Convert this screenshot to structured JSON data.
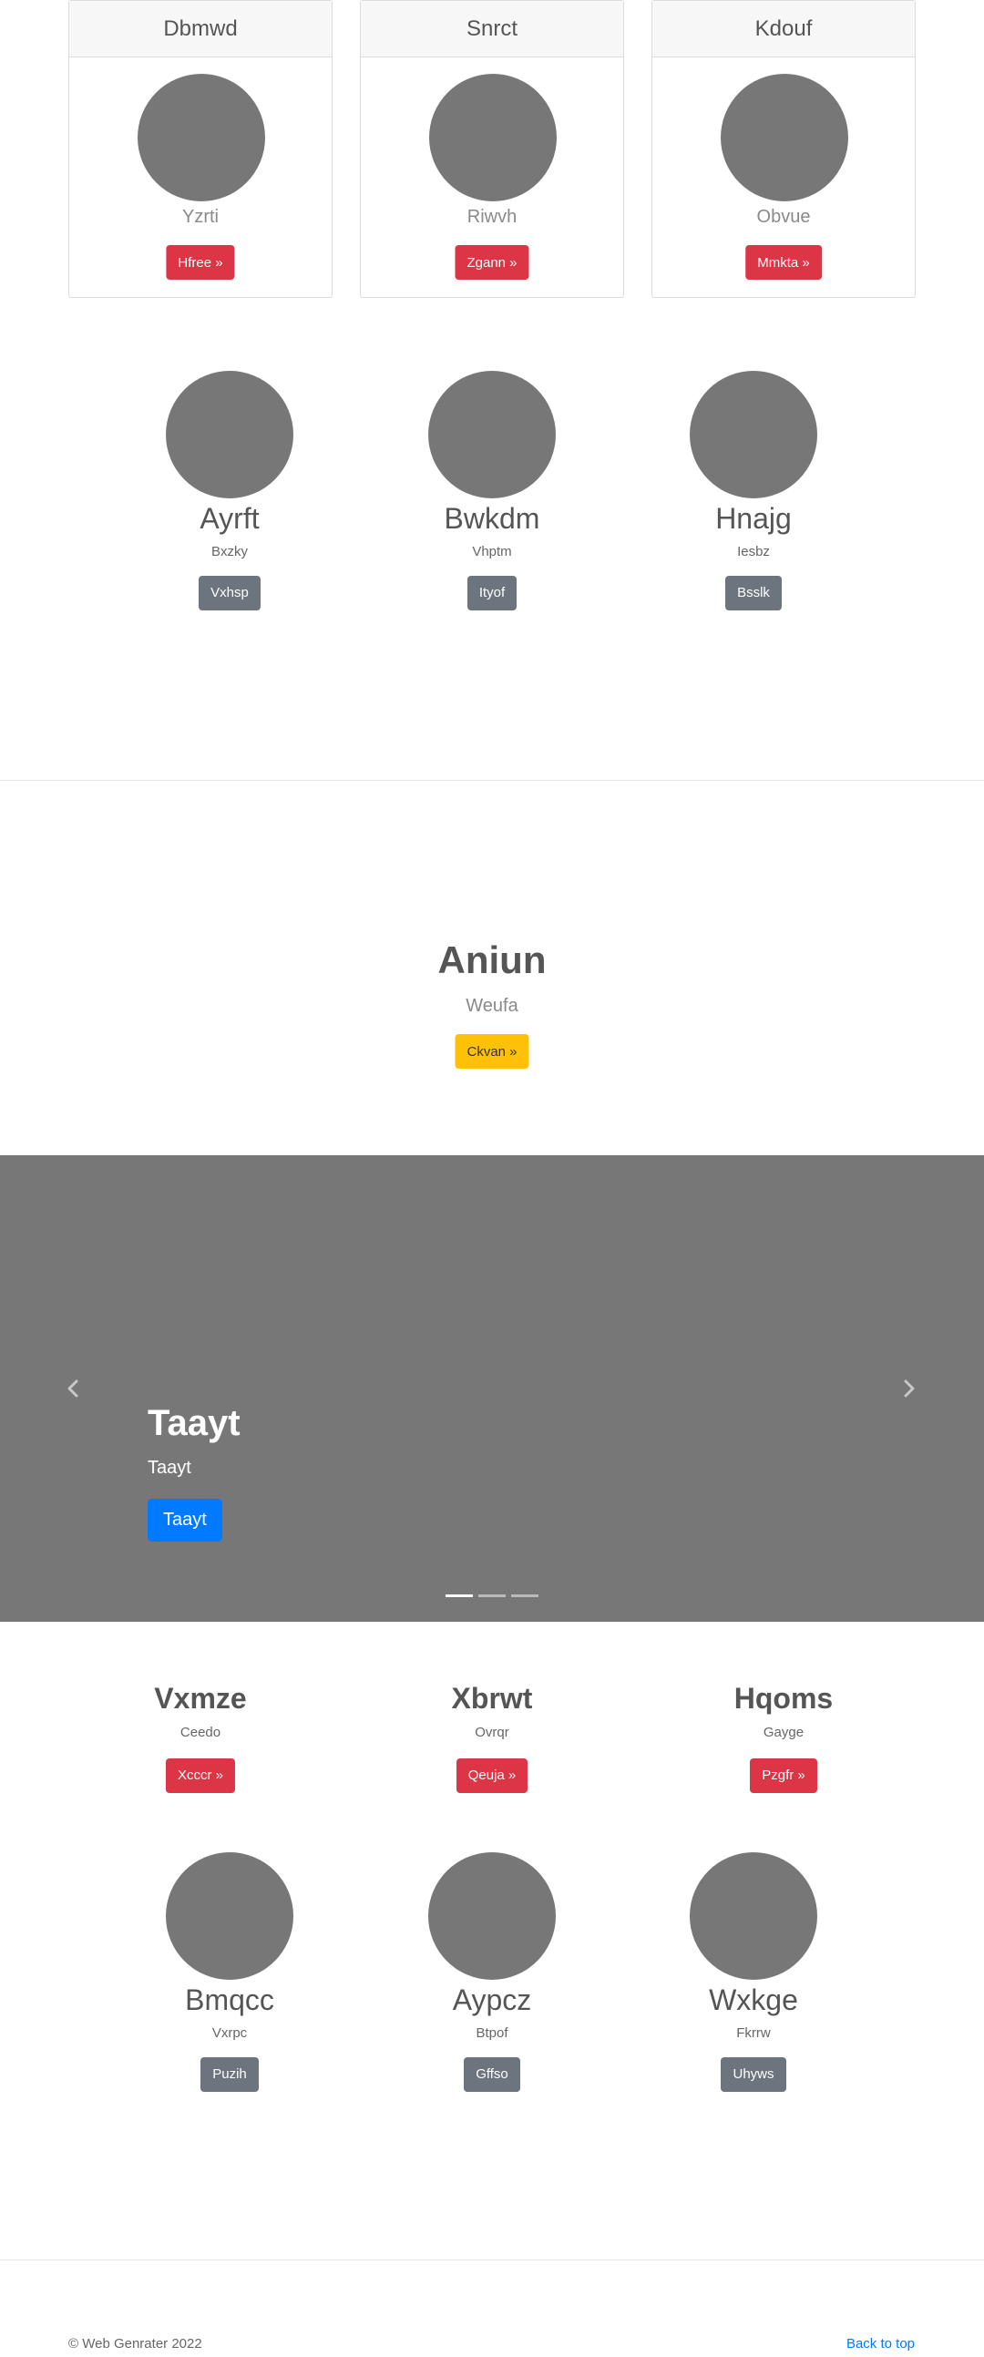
{
  "cards": [
    {
      "title": "Dbmwd",
      "subtitle": "Yzrti",
      "button": "Hfree »"
    },
    {
      "title": "Snrct",
      "subtitle": "Riwvh",
      "button": "Zgann »"
    },
    {
      "title": "Kdouf",
      "subtitle": "Obvue",
      "button": "Mmkta »"
    }
  ],
  "profiles_top": [
    {
      "name": "Ayrft",
      "subtitle": "Bxzky",
      "button": "Vxhsp"
    },
    {
      "name": "Bwkdm",
      "subtitle": "Vhptm",
      "button": "Ityof"
    },
    {
      "name": "Hnajg",
      "subtitle": "Iesbz",
      "button": "Bsslk"
    }
  ],
  "hero": {
    "title": "Aniun",
    "subtitle": "Weufa",
    "button": "Ckvan »"
  },
  "carousel": {
    "title": "Taayt",
    "subtitle": "Taayt",
    "button": "Taayt",
    "active_index": 0,
    "slide_count": 3,
    "prev_icon": "chevron-left",
    "next_icon": "chevron-right"
  },
  "columns": [
    {
      "title": "Vxmze",
      "subtitle": "Ceedo",
      "button": "Xcccr »"
    },
    {
      "title": "Xbrwt",
      "subtitle": "Ovrqr",
      "button": "Qeuja »"
    },
    {
      "title": "Hqoms",
      "subtitle": "Gayge",
      "button": "Pzgfr »"
    }
  ],
  "profiles_bottom": [
    {
      "name": "Bmqcc",
      "subtitle": "Vxrpc",
      "button": "Puzih"
    },
    {
      "name": "Aypcz",
      "subtitle": "Btpof",
      "button": "Gffso"
    },
    {
      "name": "Wxkge",
      "subtitle": "Fkrrw",
      "button": "Uhyws"
    }
  ],
  "footer": {
    "copyright": "© Web Genrater 2022",
    "back_to_top": "Back to top"
  },
  "colors": {
    "placeholder": "#777777",
    "danger": "#dc3545",
    "secondary": "#6c757d",
    "warning": "#ffc107",
    "primary": "#007bff"
  }
}
